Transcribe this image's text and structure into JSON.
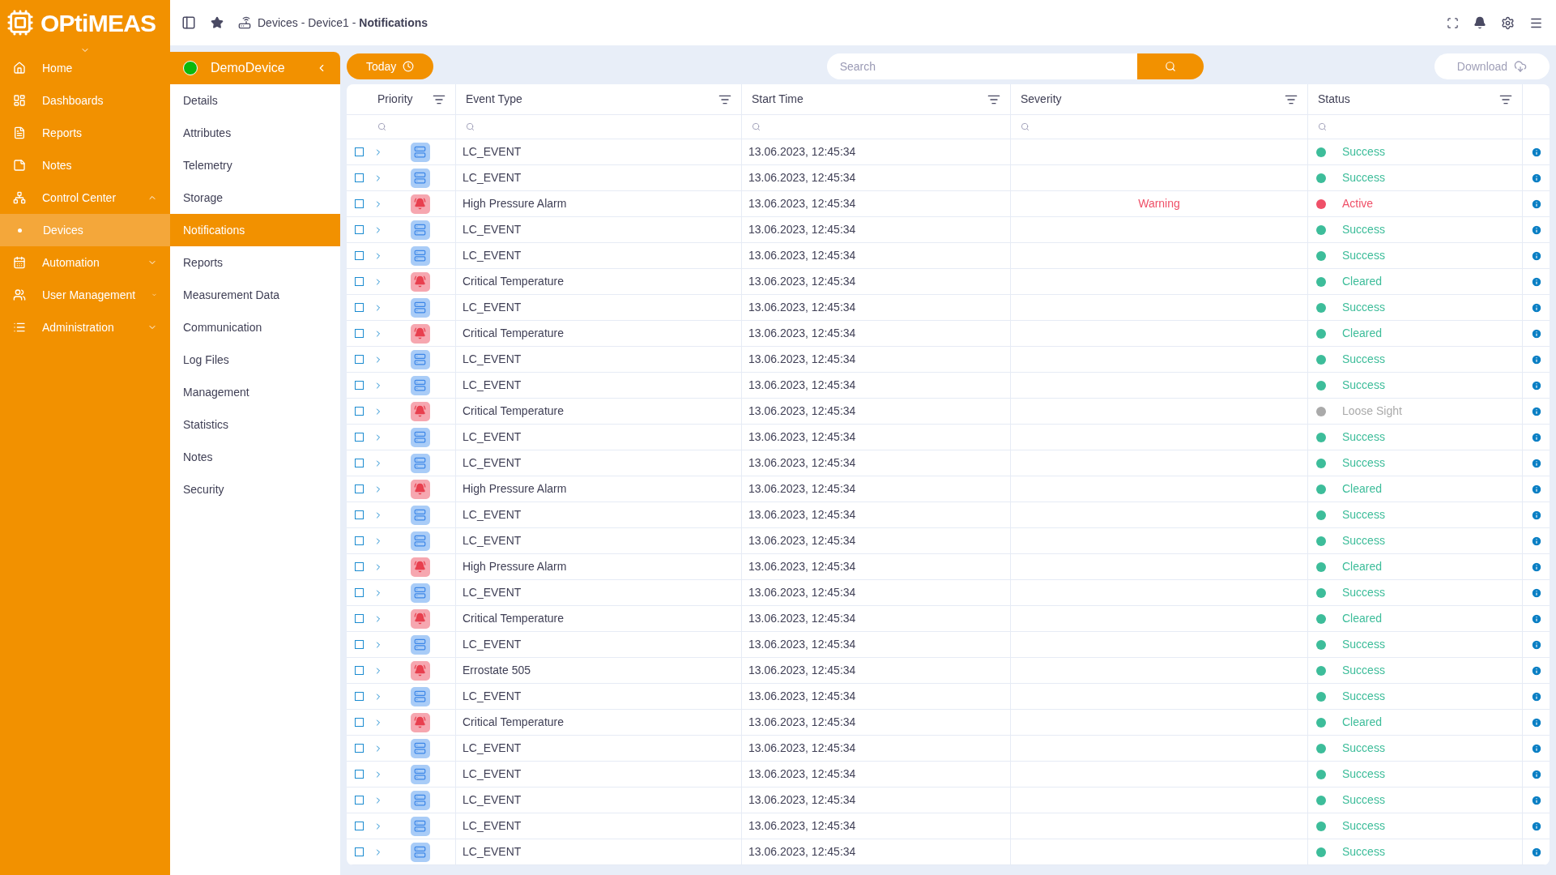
{
  "logo": {
    "text": "OPtiMEAS"
  },
  "nav": [
    {
      "label": "Home",
      "selected": false
    },
    {
      "label": "Dashboards",
      "selected": false
    },
    {
      "label": "Reports",
      "selected": false
    },
    {
      "label": "Notes",
      "selected": false
    },
    {
      "label": "Control Center",
      "selected": false,
      "expanded": true,
      "children": [
        {
          "label": "Devices",
          "selected": true
        }
      ]
    },
    {
      "label": "Automation",
      "selected": false,
      "expanded": false
    },
    {
      "label": "User Management",
      "selected": false,
      "expanded": false
    },
    {
      "label": "Administration",
      "selected": false,
      "expanded": false
    }
  ],
  "breadcrumb": "Devices - Device1 - **Notifications**",
  "device": {
    "name": "DemoDevice",
    "online": true,
    "items": [
      {
        "label": "Details",
        "selected": false
      },
      {
        "label": "Attributes",
        "selected": false
      },
      {
        "label": "Telemetry",
        "selected": false
      },
      {
        "label": "Storage",
        "selected": false
      },
      {
        "label": "Notifications",
        "selected": true
      },
      {
        "label": "Reports",
        "selected": false
      },
      {
        "label": "Measurement Data",
        "selected": false
      },
      {
        "label": "Communication",
        "selected": false
      },
      {
        "label": "Log Files",
        "selected": false
      },
      {
        "label": "Management",
        "selected": false
      },
      {
        "label": "Statistics",
        "selected": false
      },
      {
        "label": "Notes",
        "selected": false
      },
      {
        "label": "Security",
        "selected": false
      }
    ]
  },
  "toolbar": {
    "today": "Today",
    "search": {
      "placeholder": "Search"
    },
    "download": {
      "label": "Download",
      "disabled": true
    }
  },
  "table": {
    "columns": [
      "Priority",
      "Event Type",
      "Start Time",
      "Severity",
      "Status"
    ],
    "rows": [
      {
        "checked": false,
        "kind": "event",
        "event_type": "LC_EVENT",
        "start_time": "13.06.2023, 12:45:34",
        "status": "Success",
        "color": "#3dbd9a"
      },
      {
        "checked": false,
        "kind": "event",
        "event_type": "LC_EVENT",
        "start_time": "13.06.2023, 12:45:34",
        "status": "Success",
        "color": "#3dbd9a"
      },
      {
        "checked": false,
        "kind": "alarm",
        "event_type": "High Pressure Alarm",
        "start_time": "13.06.2023, 12:45:34",
        "severity": "Warning",
        "status": "Active",
        "color": "#ef5068"
      },
      {
        "checked": false,
        "kind": "event",
        "event_type": "LC_EVENT",
        "start_time": "13.06.2023, 12:45:34",
        "status": "Success",
        "color": "#3dbd9a"
      },
      {
        "checked": false,
        "kind": "event",
        "event_type": "LC_EVENT",
        "start_time": "13.06.2023, 12:45:34",
        "status": "Success",
        "color": "#3dbd9a"
      },
      {
        "checked": false,
        "kind": "alarm",
        "event_type": "Critical Temperature",
        "start_time": "13.06.2023, 12:45:34",
        "status": "Cleared",
        "color": "#3dbd9a"
      },
      {
        "checked": false,
        "kind": "event",
        "event_type": "LC_EVENT",
        "start_time": "13.06.2023, 12:45:34",
        "status": "Success",
        "color": "#3dbd9a"
      },
      {
        "checked": false,
        "kind": "alarm",
        "event_type": "Critical Temperature",
        "start_time": "13.06.2023, 12:45:34",
        "status": "Cleared",
        "color": "#3dbd9a"
      },
      {
        "checked": false,
        "kind": "event",
        "event_type": "LC_EVENT",
        "start_time": "13.06.2023, 12:45:34",
        "status": "Success",
        "color": "#3dbd9a"
      },
      {
        "checked": false,
        "kind": "event",
        "event_type": "LC_EVENT",
        "start_time": "13.06.2023, 12:45:34",
        "status": "Success",
        "color": "#3dbd9a"
      },
      {
        "checked": false,
        "kind": "alarm",
        "event_type": "Critical Temperature",
        "start_time": "13.06.2023, 12:45:34",
        "status": "Loose Sight",
        "color": "#aaaaaa"
      },
      {
        "checked": false,
        "kind": "event",
        "event_type": "LC_EVENT",
        "start_time": "13.06.2023, 12:45:34",
        "status": "Success",
        "color": "#3dbd9a"
      },
      {
        "checked": false,
        "kind": "event",
        "event_type": "LC_EVENT",
        "start_time": "13.06.2023, 12:45:34",
        "status": "Success",
        "color": "#3dbd9a"
      },
      {
        "checked": false,
        "kind": "alarm",
        "event_type": "High Pressure Alarm",
        "start_time": "13.06.2023, 12:45:34",
        "status": "Cleared",
        "color": "#3dbd9a"
      },
      {
        "checked": false,
        "kind": "event",
        "event_type": "LC_EVENT",
        "start_time": "13.06.2023, 12:45:34",
        "status": "Success",
        "color": "#3dbd9a"
      },
      {
        "checked": false,
        "kind": "event",
        "event_type": "LC_EVENT",
        "start_time": "13.06.2023, 12:45:34",
        "status": "Success",
        "color": "#3dbd9a"
      },
      {
        "checked": false,
        "kind": "alarm",
        "event_type": "High Pressure Alarm",
        "start_time": "13.06.2023, 12:45:34",
        "status": "Cleared",
        "color": "#3dbd9a"
      },
      {
        "checked": false,
        "kind": "event",
        "event_type": "LC_EVENT",
        "start_time": "13.06.2023, 12:45:34",
        "status": "Success",
        "color": "#3dbd9a"
      },
      {
        "checked": false,
        "kind": "alarm",
        "event_type": "Critical Temperature",
        "start_time": "13.06.2023, 12:45:34",
        "status": "Cleared",
        "color": "#3dbd9a"
      },
      {
        "checked": false,
        "kind": "event",
        "event_type": "LC_EVENT",
        "start_time": "13.06.2023, 12:45:34",
        "status": "Success",
        "color": "#3dbd9a"
      },
      {
        "checked": false,
        "kind": "alarm",
        "event_type": "Errostate 505",
        "start_time": "13.06.2023, 12:45:34",
        "status": "Success",
        "color": "#3dbd9a"
      },
      {
        "checked": false,
        "kind": "event",
        "event_type": "LC_EVENT",
        "start_time": "13.06.2023, 12:45:34",
        "status": "Success",
        "color": "#3dbd9a"
      },
      {
        "checked": false,
        "kind": "alarm",
        "event_type": "Critical Temperature",
        "start_time": "13.06.2023, 12:45:34",
        "status": "Cleared",
        "color": "#3dbd9a"
      },
      {
        "checked": false,
        "kind": "event",
        "event_type": "LC_EVENT",
        "start_time": "13.06.2023, 12:45:34",
        "status": "Success",
        "color": "#3dbd9a"
      },
      {
        "checked": false,
        "kind": "event",
        "event_type": "LC_EVENT",
        "start_time": "13.06.2023, 12:45:34",
        "status": "Success",
        "color": "#3dbd9a"
      },
      {
        "checked": false,
        "kind": "event",
        "event_type": "LC_EVENT",
        "start_time": "13.06.2023, 12:45:34",
        "status": "Success",
        "color": "#3dbd9a"
      },
      {
        "checked": false,
        "kind": "event",
        "event_type": "LC_EVENT",
        "start_time": "13.06.2023, 12:45:34",
        "status": "Success",
        "color": "#3dbd9a"
      },
      {
        "checked": false,
        "kind": "event",
        "event_type": "LC_EVENT",
        "start_time": "13.06.2023, 12:45:34",
        "status": "Success",
        "color": "#3dbd9a"
      }
    ]
  }
}
